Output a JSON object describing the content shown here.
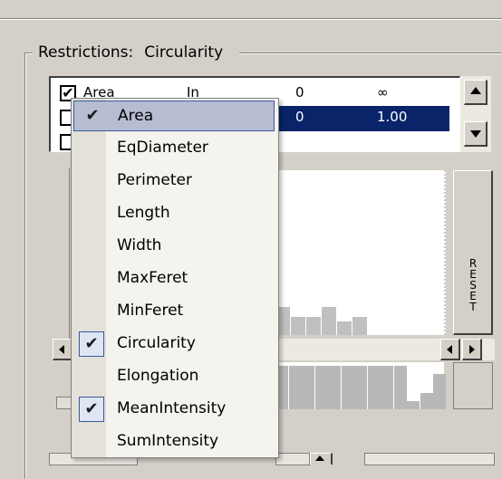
{
  "groupbox": {
    "title": "Restrictions:",
    "subtitle": "Circularity"
  },
  "list": {
    "rows": [
      {
        "checked": true,
        "name": "Area",
        "mode": "In",
        "min": "0",
        "max": "∞"
      },
      {
        "checked": false,
        "name": "",
        "mode": "",
        "min": "0",
        "max": "1.00"
      },
      {
        "checked": false,
        "name": "",
        "mode": "",
        "min": "",
        "max": ""
      }
    ]
  },
  "reset_label": "RESET",
  "histogram": {
    "upper_bars": [
      0.17,
      0.11,
      0.11,
      0.17,
      0.08,
      0.11
    ],
    "lower_bars": [
      1,
      1,
      1,
      1,
      1,
      1,
      1,
      1,
      1,
      1,
      0.19,
      0.38,
      0.82
    ]
  },
  "menu": {
    "items": [
      {
        "label": "Area",
        "checked": true,
        "highlighted": true
      },
      {
        "label": "EqDiameter",
        "checked": false,
        "highlighted": false
      },
      {
        "label": "Perimeter",
        "checked": false,
        "highlighted": false
      },
      {
        "label": "Length",
        "checked": false,
        "highlighted": false
      },
      {
        "label": "Width",
        "checked": false,
        "highlighted": false
      },
      {
        "label": "MaxFeret",
        "checked": false,
        "highlighted": false
      },
      {
        "label": "MinFeret",
        "checked": false,
        "highlighted": false
      },
      {
        "label": "Circularity",
        "checked": true,
        "highlighted": false
      },
      {
        "label": "Elongation",
        "checked": false,
        "highlighted": false
      },
      {
        "label": "MeanIntensity",
        "checked": true,
        "highlighted": false
      },
      {
        "label": "SumIntensity",
        "checked": false,
        "highlighted": false
      }
    ],
    "check_glyph": "✔"
  },
  "colors": {
    "selection": "#0a246a",
    "menu_highlight": "#b6bdd2",
    "menu_border": "#3c5a9c"
  }
}
